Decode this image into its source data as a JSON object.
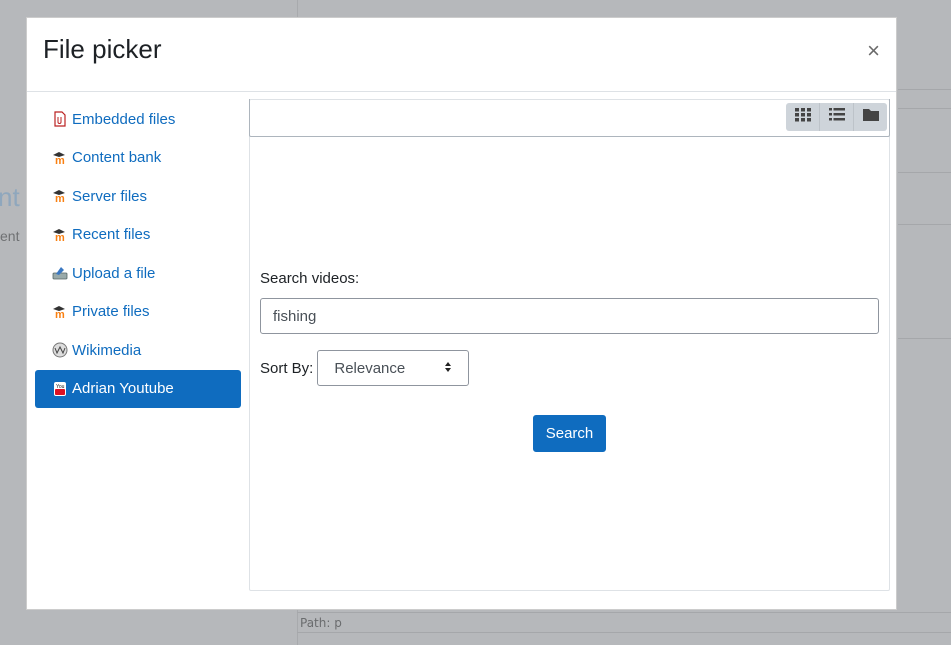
{
  "background": {
    "heading_fragment": "nt",
    "text_fragment": "ent",
    "path_label": "Path: p"
  },
  "modal": {
    "title": "File picker",
    "close_symbol": "×"
  },
  "repositories": [
    {
      "label": "Embedded files",
      "icon": "embedded-files-icon",
      "active": false
    },
    {
      "label": "Content bank",
      "icon": "moodle-icon",
      "active": false
    },
    {
      "label": "Server files",
      "icon": "moodle-icon",
      "active": false
    },
    {
      "label": "Recent files",
      "icon": "moodle-icon",
      "active": false
    },
    {
      "label": "Upload a file",
      "icon": "upload-icon",
      "active": false
    },
    {
      "label": "Private files",
      "icon": "moodle-icon",
      "active": false
    },
    {
      "label": "Wikimedia",
      "icon": "wikimedia-icon",
      "active": false
    },
    {
      "label": "Adrian Youtube",
      "icon": "youtube-icon",
      "active": true
    }
  ],
  "toolbar": {
    "views": [
      "grid-view-icon",
      "list-view-icon",
      "folder-view-icon"
    ]
  },
  "search_form": {
    "label": "Search videos:",
    "query": "fishing",
    "sort_label": "Sort By:",
    "sort_value": "Relevance",
    "search_button": "Search"
  },
  "colors": {
    "accent": "#0f6cbf",
    "moodle_orange": "#f98012"
  }
}
